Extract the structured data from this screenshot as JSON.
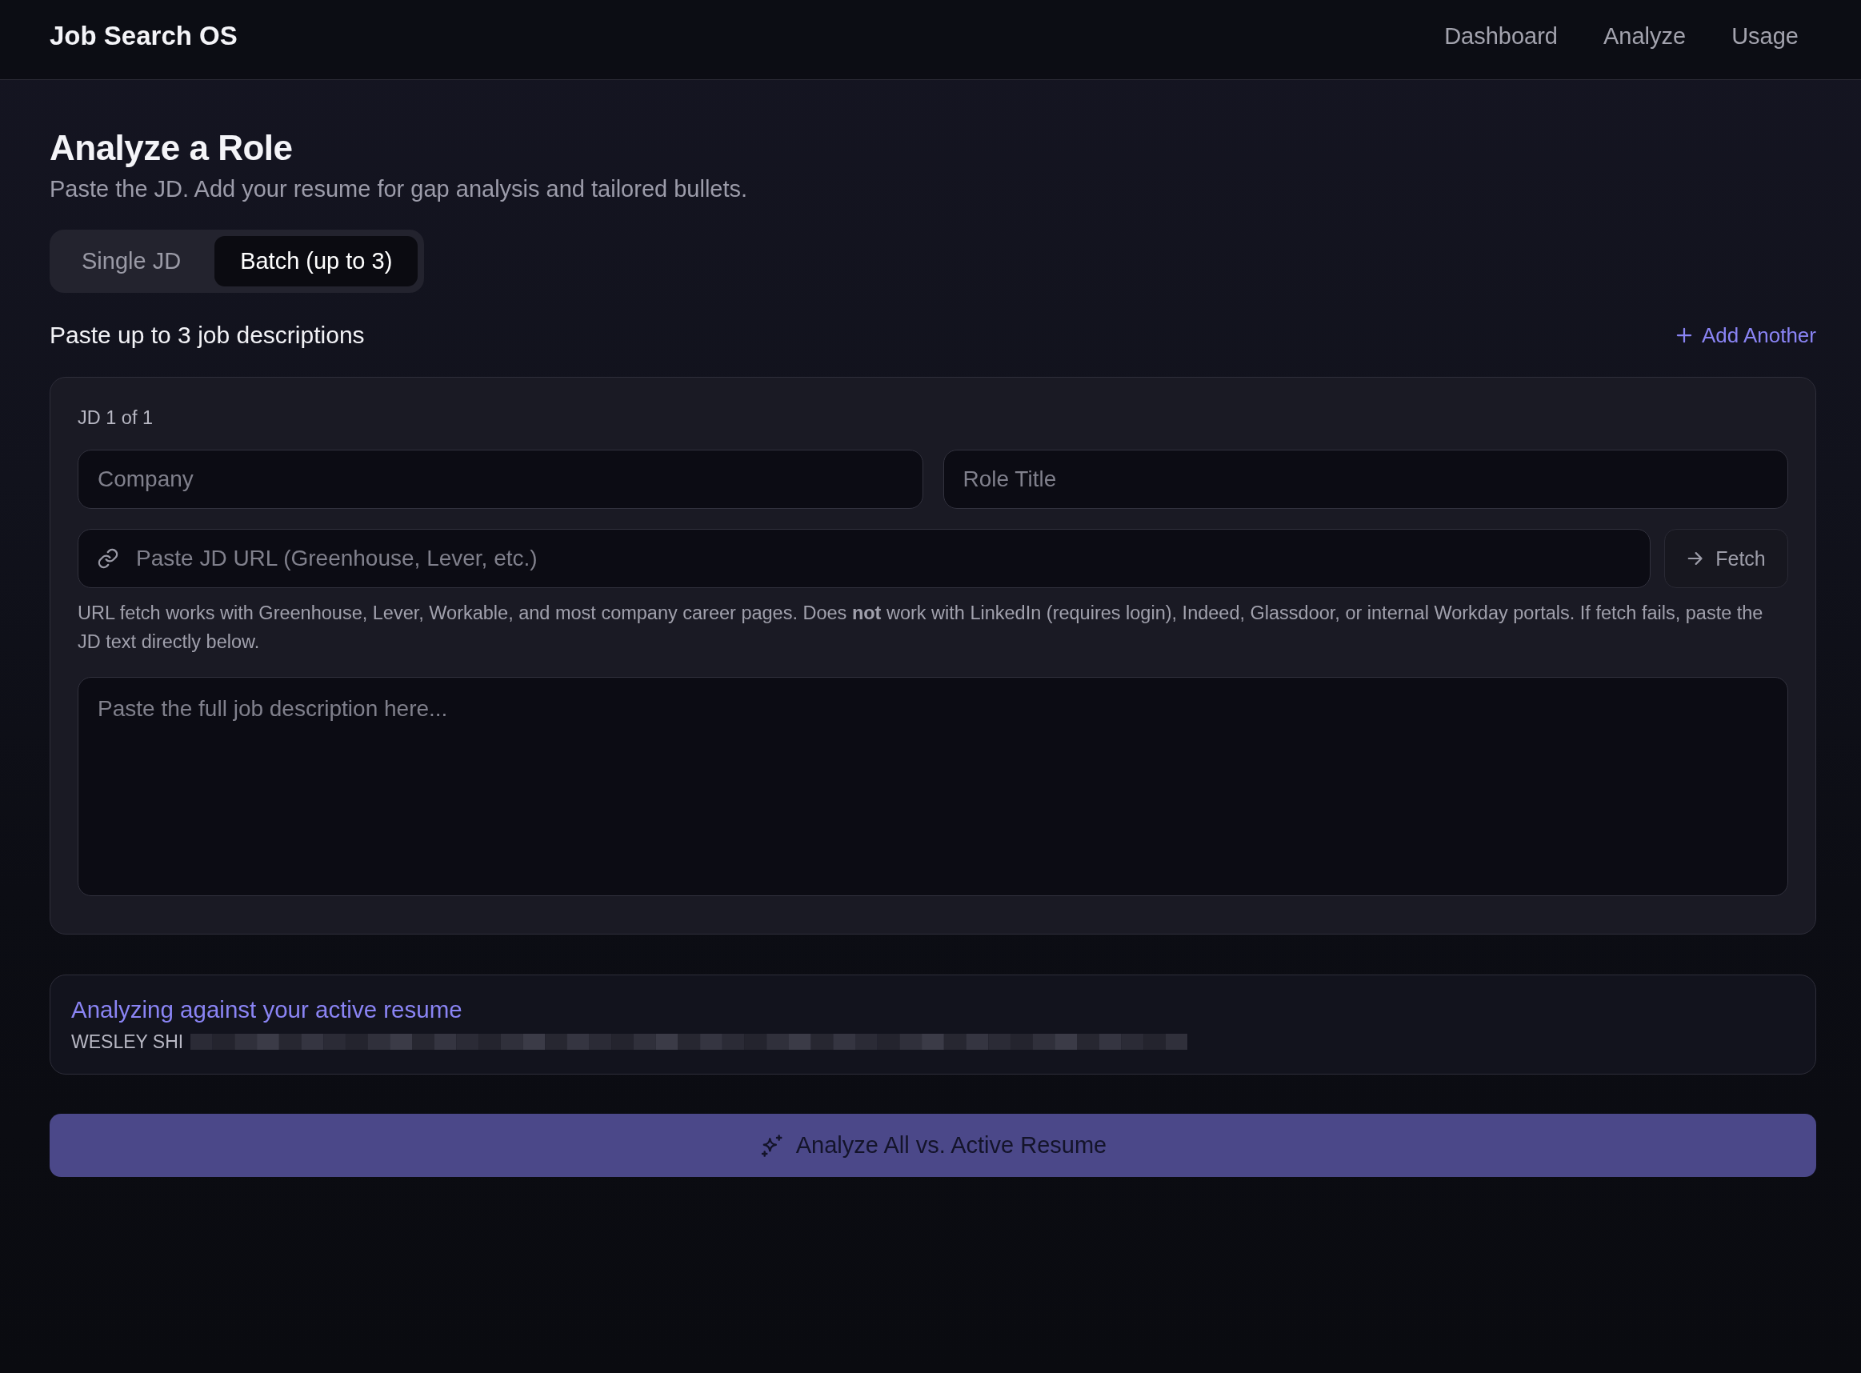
{
  "header": {
    "brand": "Job Search OS",
    "nav": [
      {
        "label": "Dashboard",
        "selected": false
      },
      {
        "label": "Analyze",
        "selected": false
      },
      {
        "label": "Usage",
        "selected": false
      }
    ]
  },
  "page": {
    "title": "Analyze a Role",
    "subtitle": "Paste the JD. Add your resume for gap analysis and tailored bullets."
  },
  "mode_tabs": [
    {
      "label": "Single JD",
      "selected": false
    },
    {
      "label": "Batch (up to 3)",
      "selected": true
    }
  ],
  "batch": {
    "heading": "Paste up to 3 job descriptions",
    "add_button": "Add Another"
  },
  "jd_cards": [
    {
      "label": "JD 1 of 1",
      "company": {
        "placeholder": "Company"
      },
      "role_title": {
        "placeholder": "Role Title"
      },
      "url": {
        "placeholder": "Paste JD URL (Greenhouse, Lever, etc.)"
      },
      "fetch_button": "Fetch",
      "help_text": "URL fetch works with Greenhouse, Lever, Workable, and most company career pages. Does **not** work with LinkedIn (requires login), Indeed, Glassdoor, or internal Workday portals. If fetch fails, paste the JD text directly below.",
      "description": {
        "placeholder": "Paste the full job description here..."
      }
    }
  ],
  "resume": {
    "title": "Analyzing against your active resume",
    "name": "WESLEY SHI"
  },
  "analyze_button": "Analyze All vs. Active Resume"
}
